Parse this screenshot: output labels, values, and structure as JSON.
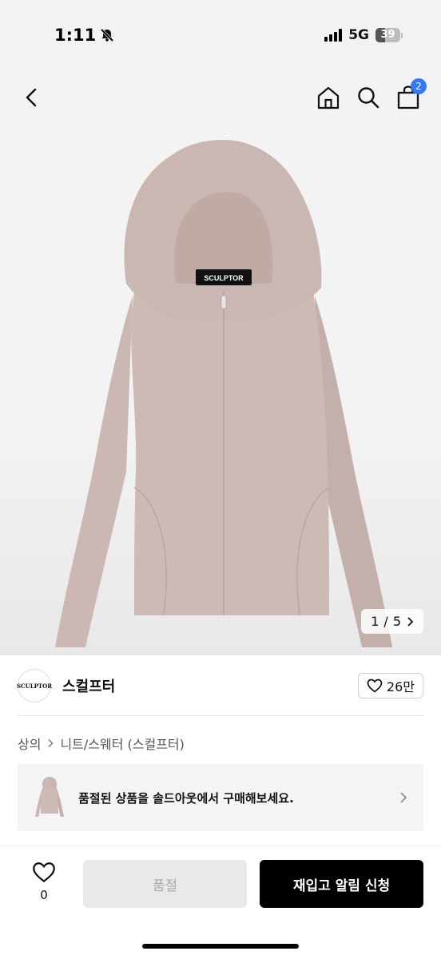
{
  "status": {
    "time": "1:11",
    "network": "5G",
    "battery": "39",
    "battery_level": 0.39
  },
  "header": {
    "cart_count": "2"
  },
  "gallery": {
    "current": "1",
    "separator": "/",
    "total": "5",
    "logo_text": "SCULPTOR"
  },
  "brand": {
    "logo_text": "SCULPTOR",
    "name": "스컬프터",
    "likes": "26만"
  },
  "breadcrumb": {
    "category": "상의",
    "subcategory": "니트/스웨터 (스컬프터)"
  },
  "banner": {
    "text": "품절된 상품을 솔드아웃에서 구매해보세요."
  },
  "footer": {
    "wish_count": "0",
    "soldout_label": "품절",
    "restock_label": "재입고 알림 신청"
  },
  "colors": {
    "accent": "#3478f6",
    "product": "#c9b5b1",
    "primary_button": "#000000",
    "disabled_button": "#e9e9e9"
  }
}
